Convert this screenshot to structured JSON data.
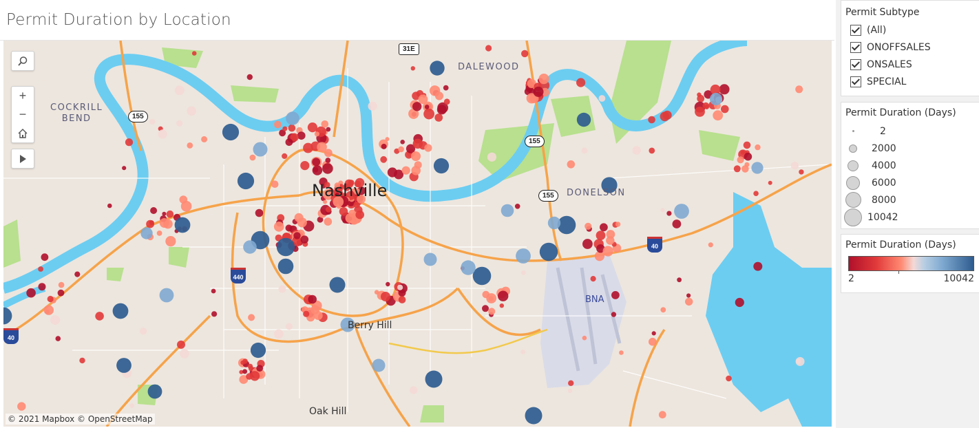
{
  "dashboard": {
    "title": "Permit Duration by Location"
  },
  "map": {
    "labels": {
      "cockrill": "COCKRILL\nBEND",
      "dalewood": "DALEWOOD",
      "donelson": "DONELSON",
      "city": "Nashville",
      "berry_hill": "Berry Hill",
      "oak_hill": "Oak Hill",
      "bna": "BNA"
    },
    "shields": {
      "h155a": "155",
      "h155b": "155",
      "h155c": "155",
      "us31e": "31E",
      "i440": "440",
      "i40a": "40",
      "i40b": "40"
    },
    "attribution": "© 2021 Mapbox  © OpenStreetMap",
    "colors": {
      "land": "#ede6de",
      "water": "#6ccdf1",
      "park": "#b8e08e",
      "highway": "#f6a34a",
      "road": "#ffffff"
    },
    "controls": {
      "search_icon": "search-icon",
      "zoom_in": "+",
      "zoom_out": "−",
      "home_icon": "home-icon",
      "play_icon": "play-icon"
    }
  },
  "filter": {
    "title": "Permit Subtype",
    "options": [
      {
        "label": "(All)",
        "checked": true
      },
      {
        "label": "ONOFFSALES",
        "checked": true
      },
      {
        "label": "ONSALES",
        "checked": true
      },
      {
        "label": "SPECIAL",
        "checked": true
      }
    ]
  },
  "size_legend": {
    "title": "Permit Duration (Days)",
    "items": [
      "2",
      "2000",
      "4000",
      "6000",
      "8000",
      "10042"
    ]
  },
  "color_legend": {
    "title": "Permit Duration (Days)",
    "min": "2",
    "max": "10042",
    "colors": [
      "#b0102b",
      "#e13a3a",
      "#ff8a73",
      "#f4d9d6",
      "#b9cfe3",
      "#7fa9d0",
      "#2e5c8f"
    ]
  }
}
